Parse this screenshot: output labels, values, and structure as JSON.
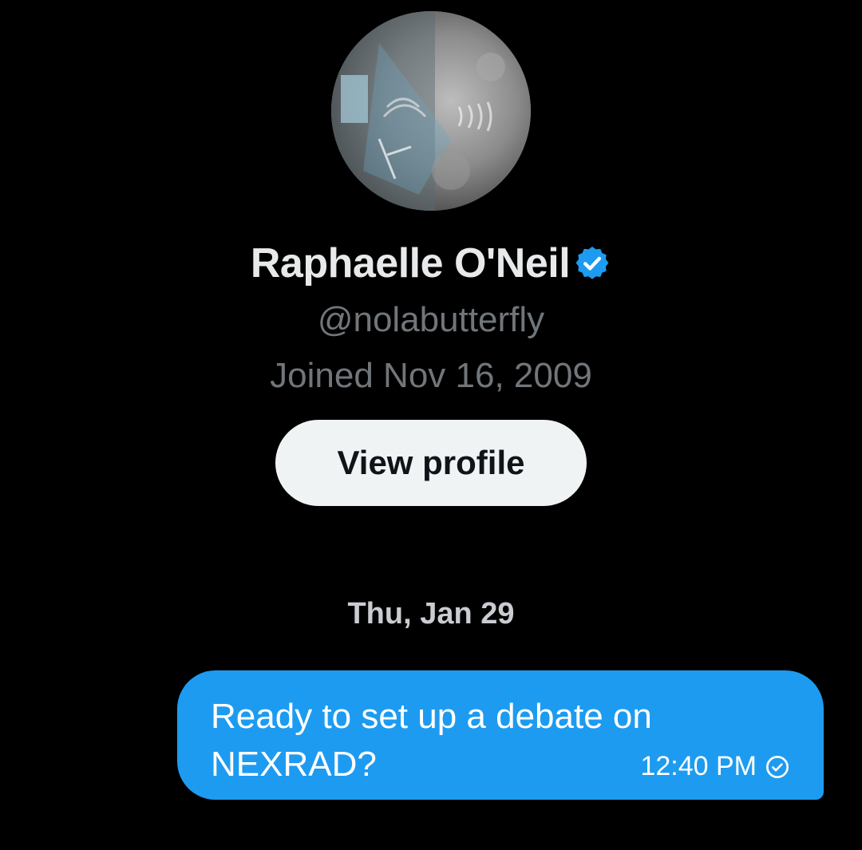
{
  "profile": {
    "avatar_icon": "avatar-image",
    "display_name": "Raphaelle O'Neil",
    "verified_icon": "verified-badge-icon",
    "handle": "@nolabutterfly",
    "joined": "Joined Nov 16, 2009",
    "view_profile_label": "View profile"
  },
  "conversation": {
    "date_separator": "Thu, Jan 29",
    "messages": [
      {
        "text": "Ready to set up a debate on NEXRAD?",
        "time": "12:40 PM",
        "status_icon": "check-circle-icon",
        "direction": "outgoing"
      }
    ]
  },
  "colors": {
    "background": "#000000",
    "bubble": "#1d9bf0",
    "secondary_text": "#71767b",
    "button_bg": "#eff3f4",
    "verified": "#1d9bf0"
  }
}
